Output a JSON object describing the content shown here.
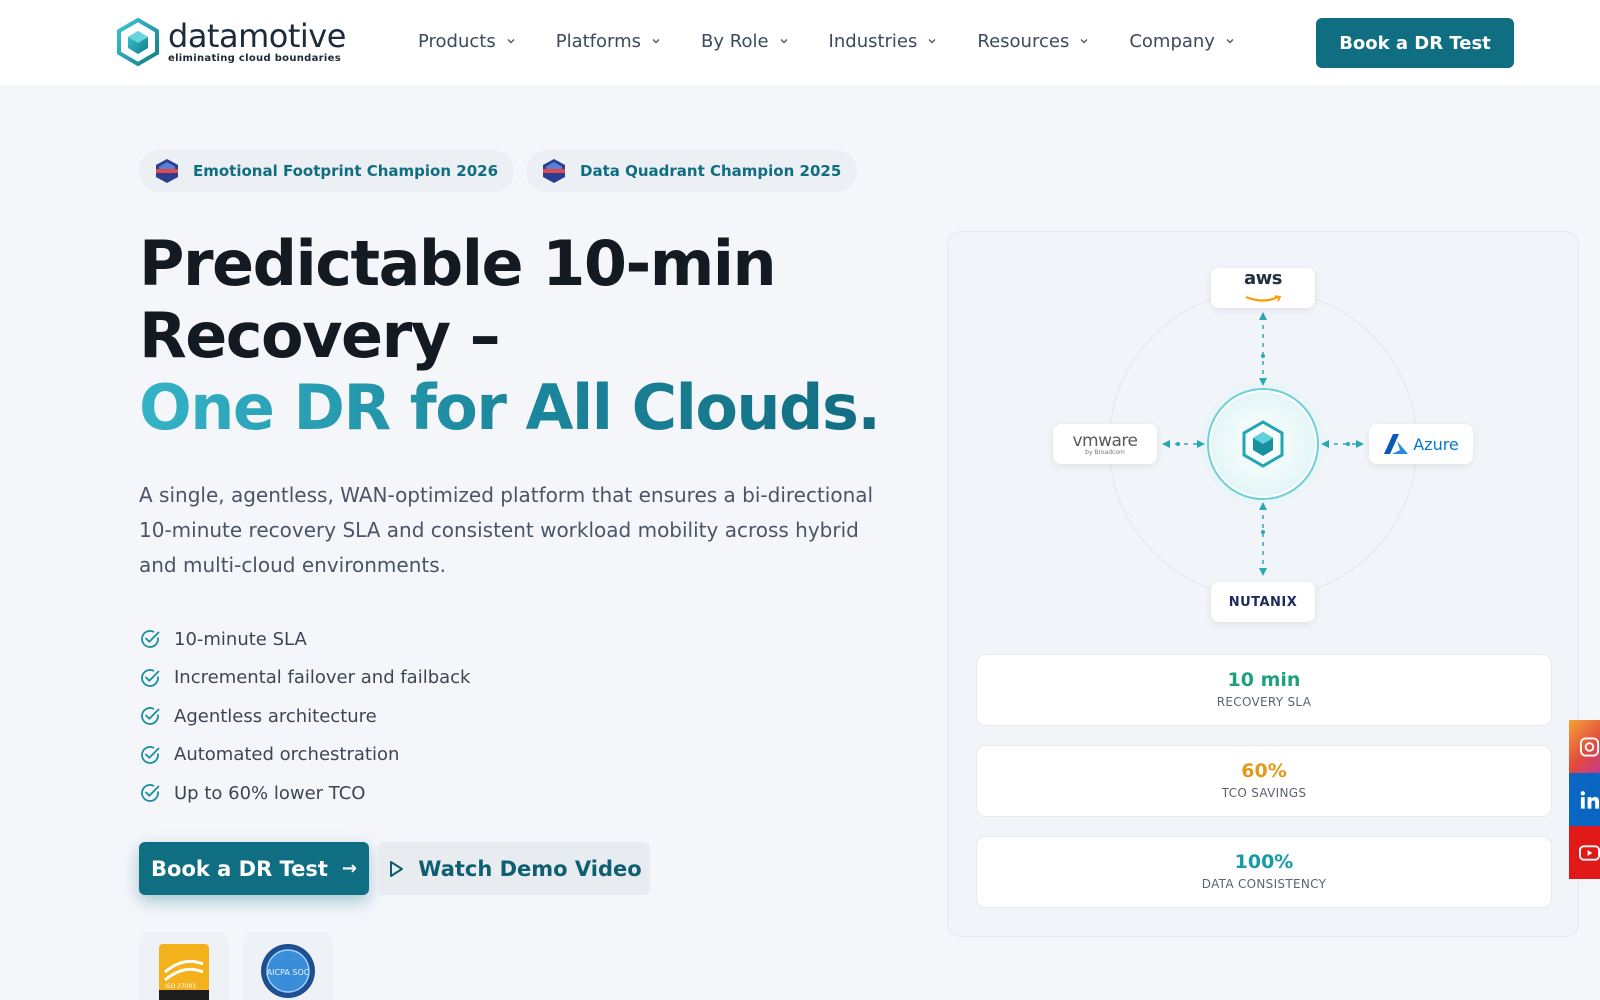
{
  "brand": {
    "name": "datamotive",
    "tagline": "eliminating cloud boundaries",
    "primary_color": "#0f6e82",
    "accent_color": "#2fa9bd"
  },
  "nav": {
    "items": [
      {
        "label": "Products"
      },
      {
        "label": "Platforms"
      },
      {
        "label": "By Role"
      },
      {
        "label": "Industries"
      },
      {
        "label": "Resources"
      },
      {
        "label": "Company"
      }
    ],
    "cta_label": "Book a DR Test"
  },
  "hero": {
    "badges": [
      {
        "label": "Emotional Footprint Champion 2026"
      },
      {
        "label": "Data Quadrant Champion 2025"
      }
    ],
    "headline_line1": "Predictable 10-min",
    "headline_line2": "Recovery –",
    "headline_accent": "One DR for All Clouds.",
    "lead": "A single, agentless, WAN-optimized platform that ensures a bi-directional 10-minute recovery SLA and consistent workload mobility across hybrid and multi-cloud environments.",
    "features": [
      {
        "label": "10-minute SLA"
      },
      {
        "label": "Incremental failover and failback"
      },
      {
        "label": "Agentless architecture"
      },
      {
        "label": "Automated orchestration"
      },
      {
        "label": "Up to 60% lower TCO"
      }
    ],
    "primary_cta": "Book a DR Test",
    "primary_cta_arrow": "→",
    "secondary_cta": "Watch Demo Video"
  },
  "certs": [
    {
      "label": "ISO 27001",
      "icon": "iso-badge"
    },
    {
      "label": "AICPA SOC",
      "icon": "aicpa-soc-badge"
    }
  ],
  "diagram": {
    "center_icon": "datamotive-hex-icon",
    "clouds": {
      "aws": {
        "label": "aws"
      },
      "vmware": {
        "label": "vmware",
        "sub": "by Broadcom"
      },
      "azure": {
        "label": "Azure"
      },
      "nutanix": {
        "label": "NUTANIX"
      }
    }
  },
  "stats": [
    {
      "value": "10 min",
      "label": "RECOVERY SLA",
      "color": "#1fa27c"
    },
    {
      "value": "60%",
      "label": "TCO SAVINGS",
      "color": "#e39a1b"
    },
    {
      "value": "100%",
      "label": "DATA CONSISTENCY",
      "color": "#1a9aa8"
    }
  ],
  "social": [
    {
      "icon": "instagram-icon",
      "color": "#e8554a"
    },
    {
      "icon": "linkedin-icon",
      "color": "#0a66c2"
    },
    {
      "icon": "youtube-icon",
      "color": "#e01818"
    }
  ]
}
